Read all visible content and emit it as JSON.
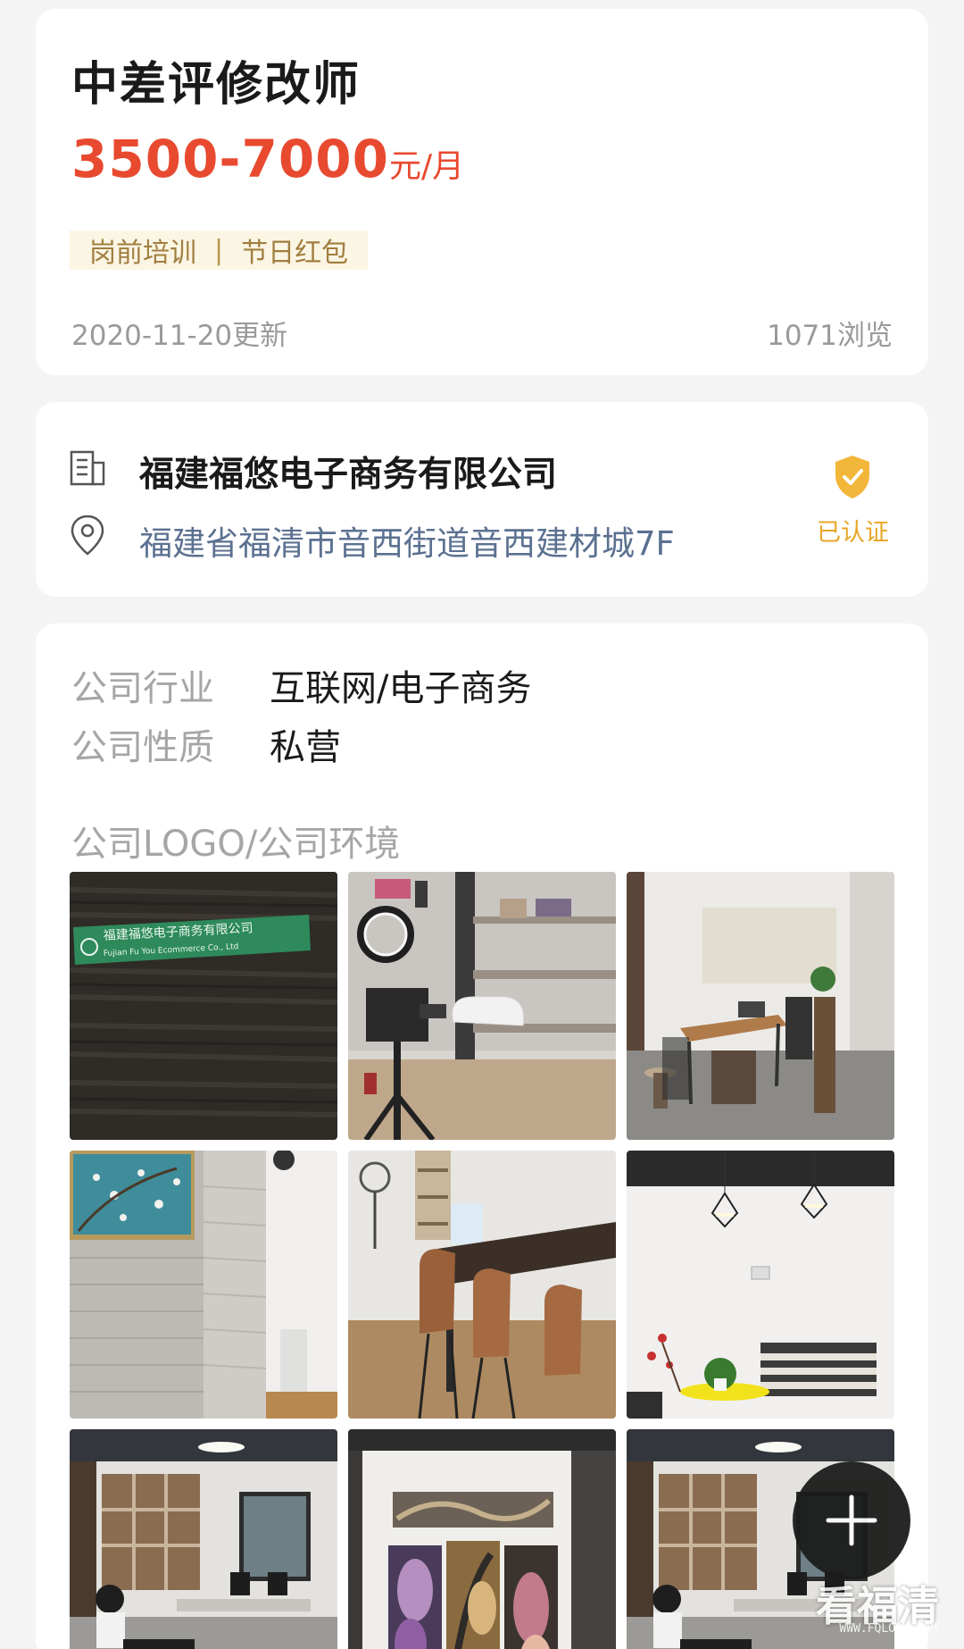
{
  "job": {
    "title": "中差评修改师",
    "salary_range": "3500-7000",
    "salary_unit": "元/月",
    "welfare": [
      "岗前培训",
      "节日红包"
    ],
    "welfare_separator": "|",
    "updated": "2020-11-20更新",
    "views": "1071浏览"
  },
  "company": {
    "name": "福建福悠电子商务有限公司",
    "address": "福建省福清市音西街道音西建材城7F",
    "verified_label": "已认证",
    "icons": [
      "building-icon",
      "location-pin-icon",
      "verified-shield-icon"
    ]
  },
  "info": {
    "industry_label": "公司行业",
    "industry_value": "互联网/电子商务",
    "nature_label": "公司性质",
    "nature_value": "私营",
    "gallery_label": "公司LOGO/公司环境",
    "sign_text": "福建福悠电子商务有限公司",
    "sign_text_en": "Fujian Fu You Ecommerce Co., Ltd"
  },
  "gallery_photos": [
    "company-sign-photo",
    "live-studio-photo",
    "tea-room-photo",
    "painting-wall-photo",
    "break-area-photo",
    "lounge-photo",
    "office-photo",
    "art-display-photo",
    "office-photo"
  ],
  "watermark": {
    "text": "看福清",
    "sub": "WWW.FQLOOK.COM"
  },
  "colors": {
    "salary": "#e84a30",
    "welfare_bg": "#fbf5e4",
    "welfare_text": "#a07e3e",
    "address": "#5c7191",
    "verified": "#e8a626",
    "background": "#f4f4f4"
  }
}
